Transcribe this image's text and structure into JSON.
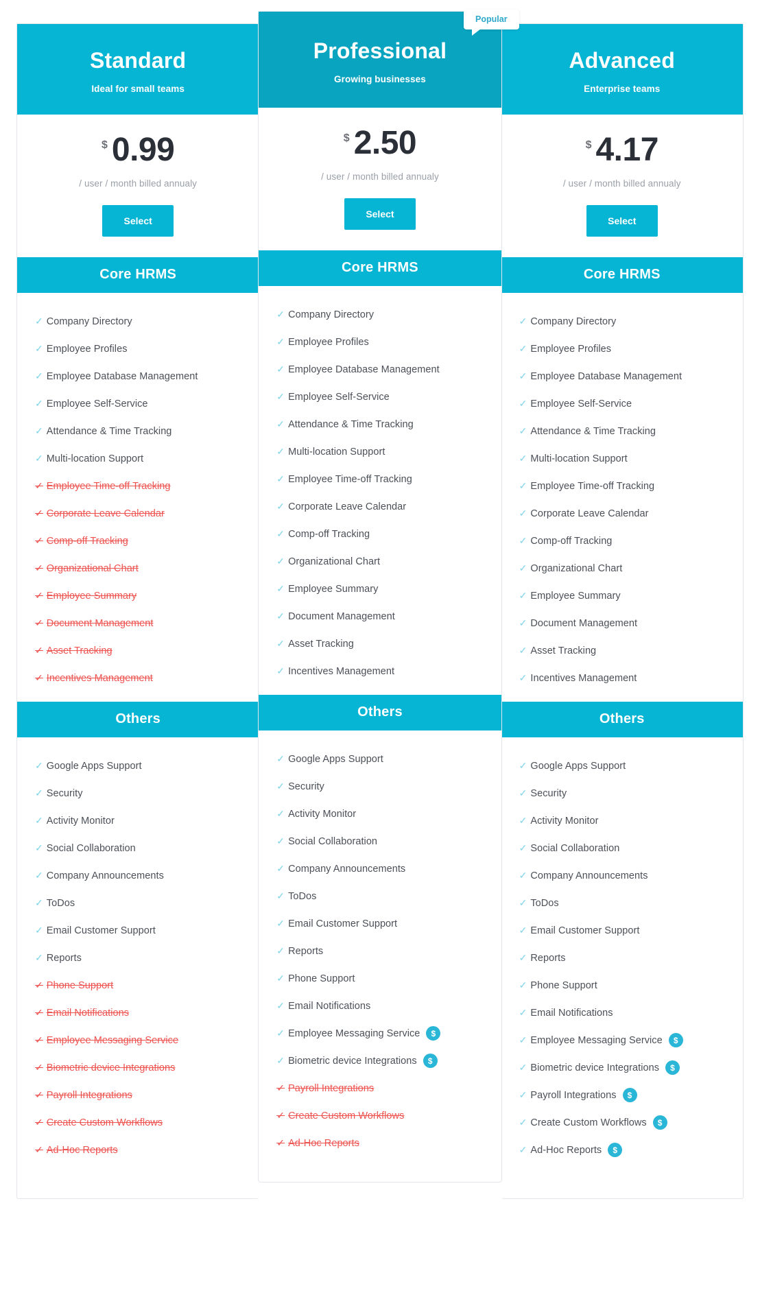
{
  "theme": {
    "accent": "#06b4d4",
    "accent_dark": "#09a4c0",
    "disabled": "#ef5350",
    "tick": "#7fd4ea",
    "pay_badge": "#2ab6d6",
    "text": "#4b5058"
  },
  "icons": {
    "tick": "✓",
    "dollar": "$"
  },
  "sections": {
    "core": "Core HRMS",
    "others": "Others"
  },
  "badge": {
    "label": "Popular"
  },
  "plans": [
    {
      "key": "standard",
      "name": "Standard",
      "tagline": "Ideal for small teams",
      "currency": "$",
      "price": "0.99",
      "period": "/ user / month billed annualy",
      "cta": "Select",
      "popular": false,
      "core": [
        {
          "label": "Company Directory",
          "enabled": true,
          "paid": false
        },
        {
          "label": "Employee Profiles",
          "enabled": true,
          "paid": false
        },
        {
          "label": "Employee Database Management",
          "enabled": true,
          "paid": false
        },
        {
          "label": "Employee Self-Service",
          "enabled": true,
          "paid": false
        },
        {
          "label": "Attendance & Time Tracking",
          "enabled": true,
          "paid": false
        },
        {
          "label": "Multi-location Support",
          "enabled": true,
          "paid": false
        },
        {
          "label": "Employee Time-off Tracking",
          "enabled": false,
          "paid": false
        },
        {
          "label": "Corporate Leave Calendar",
          "enabled": false,
          "paid": false
        },
        {
          "label": "Comp-off Tracking",
          "enabled": false,
          "paid": false
        },
        {
          "label": "Organizational Chart",
          "enabled": false,
          "paid": false
        },
        {
          "label": "Employee Summary",
          "enabled": false,
          "paid": false
        },
        {
          "label": "Document Management",
          "enabled": false,
          "paid": false
        },
        {
          "label": "Asset Tracking",
          "enabled": false,
          "paid": false
        },
        {
          "label": "Incentives Management",
          "enabled": false,
          "paid": false
        }
      ],
      "others": [
        {
          "label": "Google Apps Support",
          "enabled": true,
          "paid": false
        },
        {
          "label": "Security",
          "enabled": true,
          "paid": false
        },
        {
          "label": "Activity Monitor",
          "enabled": true,
          "paid": false
        },
        {
          "label": "Social Collaboration",
          "enabled": true,
          "paid": false
        },
        {
          "label": "Company Announcements",
          "enabled": true,
          "paid": false
        },
        {
          "label": "ToDos",
          "enabled": true,
          "paid": false
        },
        {
          "label": "Email Customer Support",
          "enabled": true,
          "paid": false
        },
        {
          "label": "Reports",
          "enabled": true,
          "paid": false
        },
        {
          "label": "Phone Support",
          "enabled": false,
          "paid": false
        },
        {
          "label": "Email Notifications",
          "enabled": false,
          "paid": false
        },
        {
          "label": "Employee Messaging Service",
          "enabled": false,
          "paid": false
        },
        {
          "label": "Biometric device Integrations",
          "enabled": false,
          "paid": false
        },
        {
          "label": "Payroll Integrations",
          "enabled": false,
          "paid": false
        },
        {
          "label": "Create Custom Workflows",
          "enabled": false,
          "paid": false
        },
        {
          "label": "Ad-Hoc Reports",
          "enabled": false,
          "paid": false
        }
      ]
    },
    {
      "key": "professional",
      "name": "Professional",
      "tagline": "Growing businesses",
      "currency": "$",
      "price": "2.50",
      "period": "/ user / month billed annualy",
      "cta": "Select",
      "popular": true,
      "core": [
        {
          "label": "Company Directory",
          "enabled": true,
          "paid": false
        },
        {
          "label": "Employee Profiles",
          "enabled": true,
          "paid": false
        },
        {
          "label": "Employee Database Management",
          "enabled": true,
          "paid": false
        },
        {
          "label": "Employee Self-Service",
          "enabled": true,
          "paid": false
        },
        {
          "label": "Attendance & Time Tracking",
          "enabled": true,
          "paid": false
        },
        {
          "label": "Multi-location Support",
          "enabled": true,
          "paid": false
        },
        {
          "label": "Employee Time-off Tracking",
          "enabled": true,
          "paid": false
        },
        {
          "label": "Corporate Leave Calendar",
          "enabled": true,
          "paid": false
        },
        {
          "label": "Comp-off Tracking",
          "enabled": true,
          "paid": false
        },
        {
          "label": "Organizational Chart",
          "enabled": true,
          "paid": false
        },
        {
          "label": "Employee Summary",
          "enabled": true,
          "paid": false
        },
        {
          "label": "Document Management",
          "enabled": true,
          "paid": false
        },
        {
          "label": "Asset Tracking",
          "enabled": true,
          "paid": false
        },
        {
          "label": "Incentives Management",
          "enabled": true,
          "paid": false
        }
      ],
      "others": [
        {
          "label": "Google Apps Support",
          "enabled": true,
          "paid": false
        },
        {
          "label": "Security",
          "enabled": true,
          "paid": false
        },
        {
          "label": "Activity Monitor",
          "enabled": true,
          "paid": false
        },
        {
          "label": "Social Collaboration",
          "enabled": true,
          "paid": false
        },
        {
          "label": "Company Announcements",
          "enabled": true,
          "paid": false
        },
        {
          "label": "ToDos",
          "enabled": true,
          "paid": false
        },
        {
          "label": "Email Customer Support",
          "enabled": true,
          "paid": false
        },
        {
          "label": "Reports",
          "enabled": true,
          "paid": false
        },
        {
          "label": "Phone Support",
          "enabled": true,
          "paid": false
        },
        {
          "label": "Email Notifications",
          "enabled": true,
          "paid": false
        },
        {
          "label": "Employee Messaging Service",
          "enabled": true,
          "paid": true
        },
        {
          "label": "Biometric device Integrations",
          "enabled": true,
          "paid": true
        },
        {
          "label": "Payroll Integrations",
          "enabled": false,
          "paid": false
        },
        {
          "label": "Create Custom Workflows",
          "enabled": false,
          "paid": false
        },
        {
          "label": "Ad-Hoc Reports",
          "enabled": false,
          "paid": false
        }
      ]
    },
    {
      "key": "advanced",
      "name": "Advanced",
      "tagline": "Enterprise teams",
      "currency": "$",
      "price": "4.17",
      "period": "/ user / month billed annualy",
      "cta": "Select",
      "popular": false,
      "core": [
        {
          "label": "Company Directory",
          "enabled": true,
          "paid": false
        },
        {
          "label": "Employee Profiles",
          "enabled": true,
          "paid": false
        },
        {
          "label": "Employee Database Management",
          "enabled": true,
          "paid": false
        },
        {
          "label": "Employee Self-Service",
          "enabled": true,
          "paid": false
        },
        {
          "label": "Attendance & Time Tracking",
          "enabled": true,
          "paid": false
        },
        {
          "label": "Multi-location Support",
          "enabled": true,
          "paid": false
        },
        {
          "label": "Employee Time-off Tracking",
          "enabled": true,
          "paid": false
        },
        {
          "label": "Corporate Leave Calendar",
          "enabled": true,
          "paid": false
        },
        {
          "label": "Comp-off Tracking",
          "enabled": true,
          "paid": false
        },
        {
          "label": "Organizational Chart",
          "enabled": true,
          "paid": false
        },
        {
          "label": "Employee Summary",
          "enabled": true,
          "paid": false
        },
        {
          "label": "Document Management",
          "enabled": true,
          "paid": false
        },
        {
          "label": "Asset Tracking",
          "enabled": true,
          "paid": false
        },
        {
          "label": "Incentives Management",
          "enabled": true,
          "paid": false
        }
      ],
      "others": [
        {
          "label": "Google Apps Support",
          "enabled": true,
          "paid": false
        },
        {
          "label": "Security",
          "enabled": true,
          "paid": false
        },
        {
          "label": "Activity Monitor",
          "enabled": true,
          "paid": false
        },
        {
          "label": "Social Collaboration",
          "enabled": true,
          "paid": false
        },
        {
          "label": "Company Announcements",
          "enabled": true,
          "paid": false
        },
        {
          "label": "ToDos",
          "enabled": true,
          "paid": false
        },
        {
          "label": "Email Customer Support",
          "enabled": true,
          "paid": false
        },
        {
          "label": "Reports",
          "enabled": true,
          "paid": false
        },
        {
          "label": "Phone Support",
          "enabled": true,
          "paid": false
        },
        {
          "label": "Email Notifications",
          "enabled": true,
          "paid": false
        },
        {
          "label": "Employee Messaging Service",
          "enabled": true,
          "paid": true
        },
        {
          "label": "Biometric device Integrations",
          "enabled": true,
          "paid": true
        },
        {
          "label": "Payroll Integrations",
          "enabled": true,
          "paid": true
        },
        {
          "label": "Create Custom Workflows",
          "enabled": true,
          "paid": true
        },
        {
          "label": "Ad-Hoc Reports",
          "enabled": true,
          "paid": true
        }
      ]
    }
  ]
}
